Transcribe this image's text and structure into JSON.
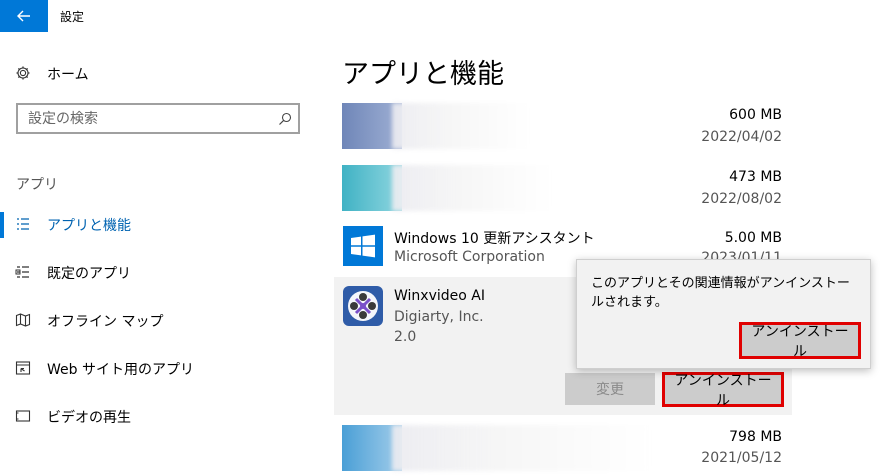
{
  "window": {
    "title": "設定"
  },
  "sidebar": {
    "home": "ホーム",
    "search_placeholder": "設定の検索",
    "section": "アプリ",
    "items": [
      {
        "label": "アプリと機能",
        "icon": "list-icon",
        "active": true
      },
      {
        "label": "既定のアプリ",
        "icon": "default-apps-icon",
        "active": false
      },
      {
        "label": "オフライン マップ",
        "icon": "map-icon",
        "active": false
      },
      {
        "label": "Web サイト用のアプリ",
        "icon": "web-apps-icon",
        "active": false
      },
      {
        "label": "ビデオの再生",
        "icon": "video-icon",
        "active": false
      }
    ]
  },
  "main": {
    "title": "アプリと機能",
    "apps": [
      {
        "name": "",
        "publisher": "",
        "size": "600 MB",
        "date": "2022/04/02",
        "blurred": true,
        "color": "#7a8fbf"
      },
      {
        "name": "",
        "publisher": "",
        "size": "473 MB",
        "date": "2022/08/02",
        "blurred": true,
        "color": "#4fb8c8"
      },
      {
        "name": "Windows 10 更新アシスタント",
        "publisher": "Microsoft Corporation",
        "size": "5.00 MB",
        "date": "2023/01/11",
        "icon": "windows-logo-icon"
      },
      {
        "name": "Winxvideo AI",
        "publisher": "Digiarty, Inc.",
        "version": "2.0",
        "selected": true,
        "icon": "winxvideo-icon",
        "modify_label": "変更",
        "uninstall_label": "アンインストール"
      },
      {
        "name": "",
        "publisher": "",
        "size": "798 MB",
        "date": "2021/05/12",
        "blurred": true,
        "color": "#5aa8d8"
      }
    ]
  },
  "flyout": {
    "message": "このアプリとその関連情報がアンインストールされます。",
    "confirm_label": "アンインストール"
  },
  "colors": {
    "accent": "#0078d7",
    "highlight": "#e00000"
  }
}
